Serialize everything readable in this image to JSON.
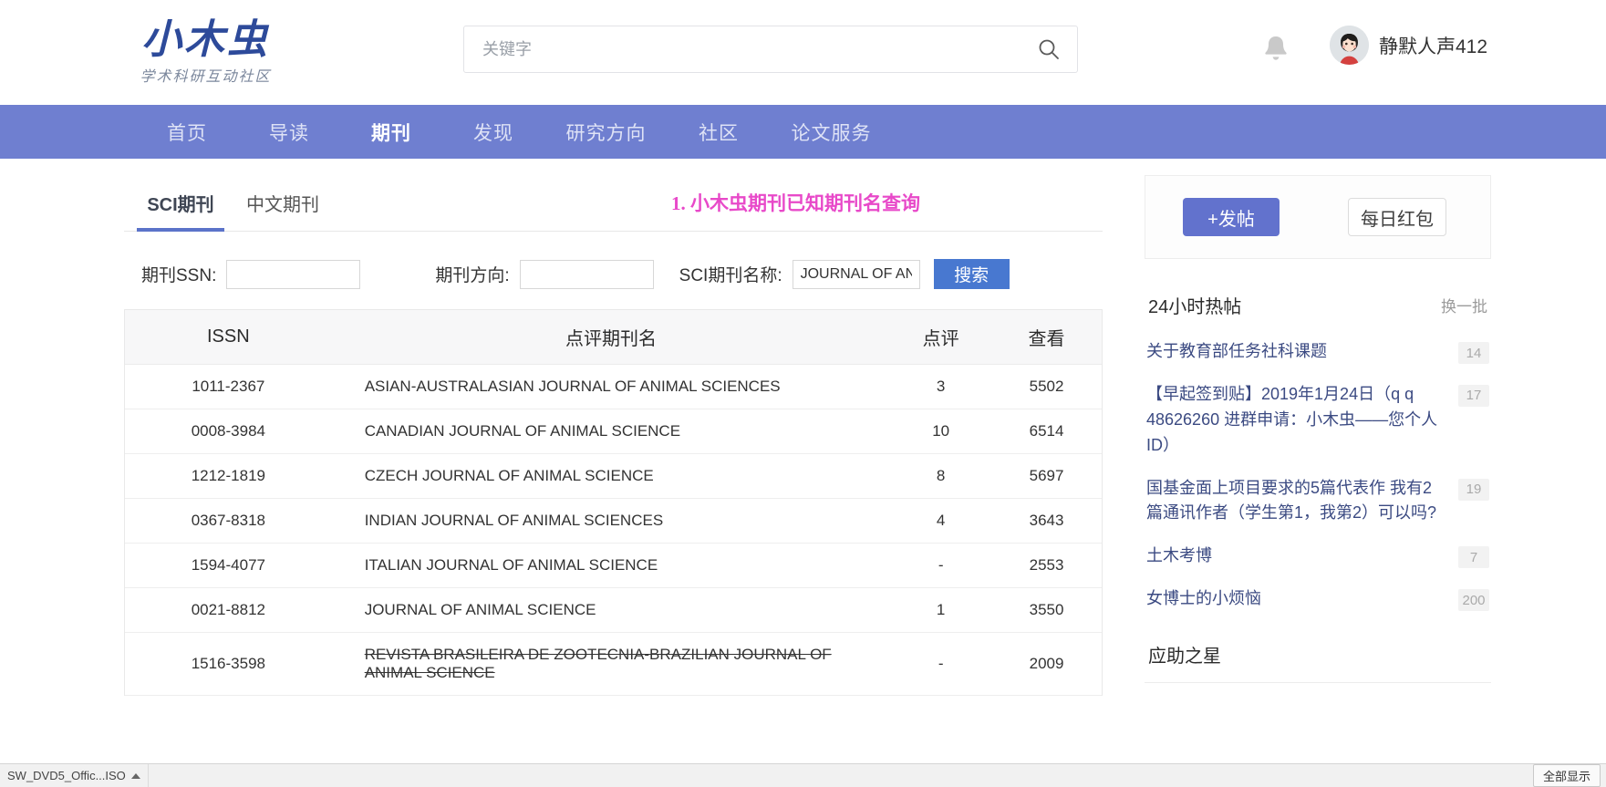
{
  "header": {
    "logo_main": "小木虫",
    "logo_sub": "学术科研互动社区",
    "search_placeholder": "关键字",
    "search_value": "",
    "username": "静默人声412"
  },
  "nav": {
    "items": [
      {
        "label": "首页",
        "active": false
      },
      {
        "label": "导读",
        "active": false
      },
      {
        "label": "期刊",
        "active": true
      },
      {
        "label": "发现",
        "active": false
      },
      {
        "label": "研究方向",
        "active": false
      },
      {
        "label": "社区",
        "active": false
      },
      {
        "label": "论文服务",
        "active": false
      }
    ]
  },
  "tabs": [
    {
      "label": "SCI期刊",
      "active": true
    },
    {
      "label": "中文期刊",
      "active": false
    }
  ],
  "annotation": "1. 小木虫期刊已知期刊名查询",
  "form": {
    "ssn_label": "期刊SSN:",
    "ssn_value": "",
    "direction_label": "期刊方向:",
    "direction_value": "",
    "name_label": "SCI期刊名称:",
    "name_value": "JOURNAL OF AN",
    "search_button": "搜索"
  },
  "table": {
    "headers": [
      "ISSN",
      "点评期刊名",
      "点评",
      "查看"
    ],
    "rows": [
      {
        "issn": "1011-2367",
        "name": "ASIAN-AUSTRALASIAN JOURNAL OF ANIMAL SCIENCES",
        "reviews": "3",
        "views": "5502",
        "strike": false
      },
      {
        "issn": "0008-3984",
        "name": "CANADIAN JOURNAL OF ANIMAL SCIENCE",
        "reviews": "10",
        "views": "6514",
        "strike": false
      },
      {
        "issn": "1212-1819",
        "name": "CZECH JOURNAL OF ANIMAL SCIENCE",
        "reviews": "8",
        "views": "5697",
        "strike": false
      },
      {
        "issn": "0367-8318",
        "name": "INDIAN JOURNAL OF ANIMAL SCIENCES",
        "reviews": "4",
        "views": "3643",
        "strike": false
      },
      {
        "issn": "1594-4077",
        "name": "ITALIAN JOURNAL OF ANIMAL SCIENCE",
        "reviews": "-",
        "views": "2553",
        "strike": false
      },
      {
        "issn": "0021-8812",
        "name": "JOURNAL OF ANIMAL SCIENCE",
        "reviews": "1",
        "views": "3550",
        "strike": false
      },
      {
        "issn": "1516-3598",
        "name": "REVISTA BRASILEIRA DE ZOOTECNIA-BRAZILIAN JOURNAL OF ANIMAL SCIENCE",
        "reviews": "-",
        "views": "2009",
        "strike": true
      }
    ]
  },
  "sidebar": {
    "post_button": "+发帖",
    "redpacket_button": "每日红包",
    "hot_title": "24小时热帖",
    "refresh_label": "换一批",
    "hot_items": [
      {
        "title": "关于教育部任务社科课题",
        "count": "14"
      },
      {
        "title": "【早起签到贴】2019年1月24日（q q 48626260 进群申请：小木虫——您个人ID）",
        "count": "17"
      },
      {
        "title": "国基金面上项目要求的5篇代表作 我有2篇通讯作者（学生第1，我第2）可以吗?",
        "count": "19"
      },
      {
        "title": "土木考博",
        "count": "7"
      },
      {
        "title": "女博士的小烦恼",
        "count": "200"
      }
    ],
    "help_star_title": "应助之星"
  },
  "taskbar": {
    "item_label": "SW_DVD5_Offic...ISO",
    "show_all_label": "全部显示"
  },
  "colors": {
    "nav_bg": "#6f7fd0",
    "accent": "#5b73c9",
    "button_blue": "#4878d0",
    "annotation_pink": "#e849c9",
    "link_blue": "#3b4a82"
  }
}
